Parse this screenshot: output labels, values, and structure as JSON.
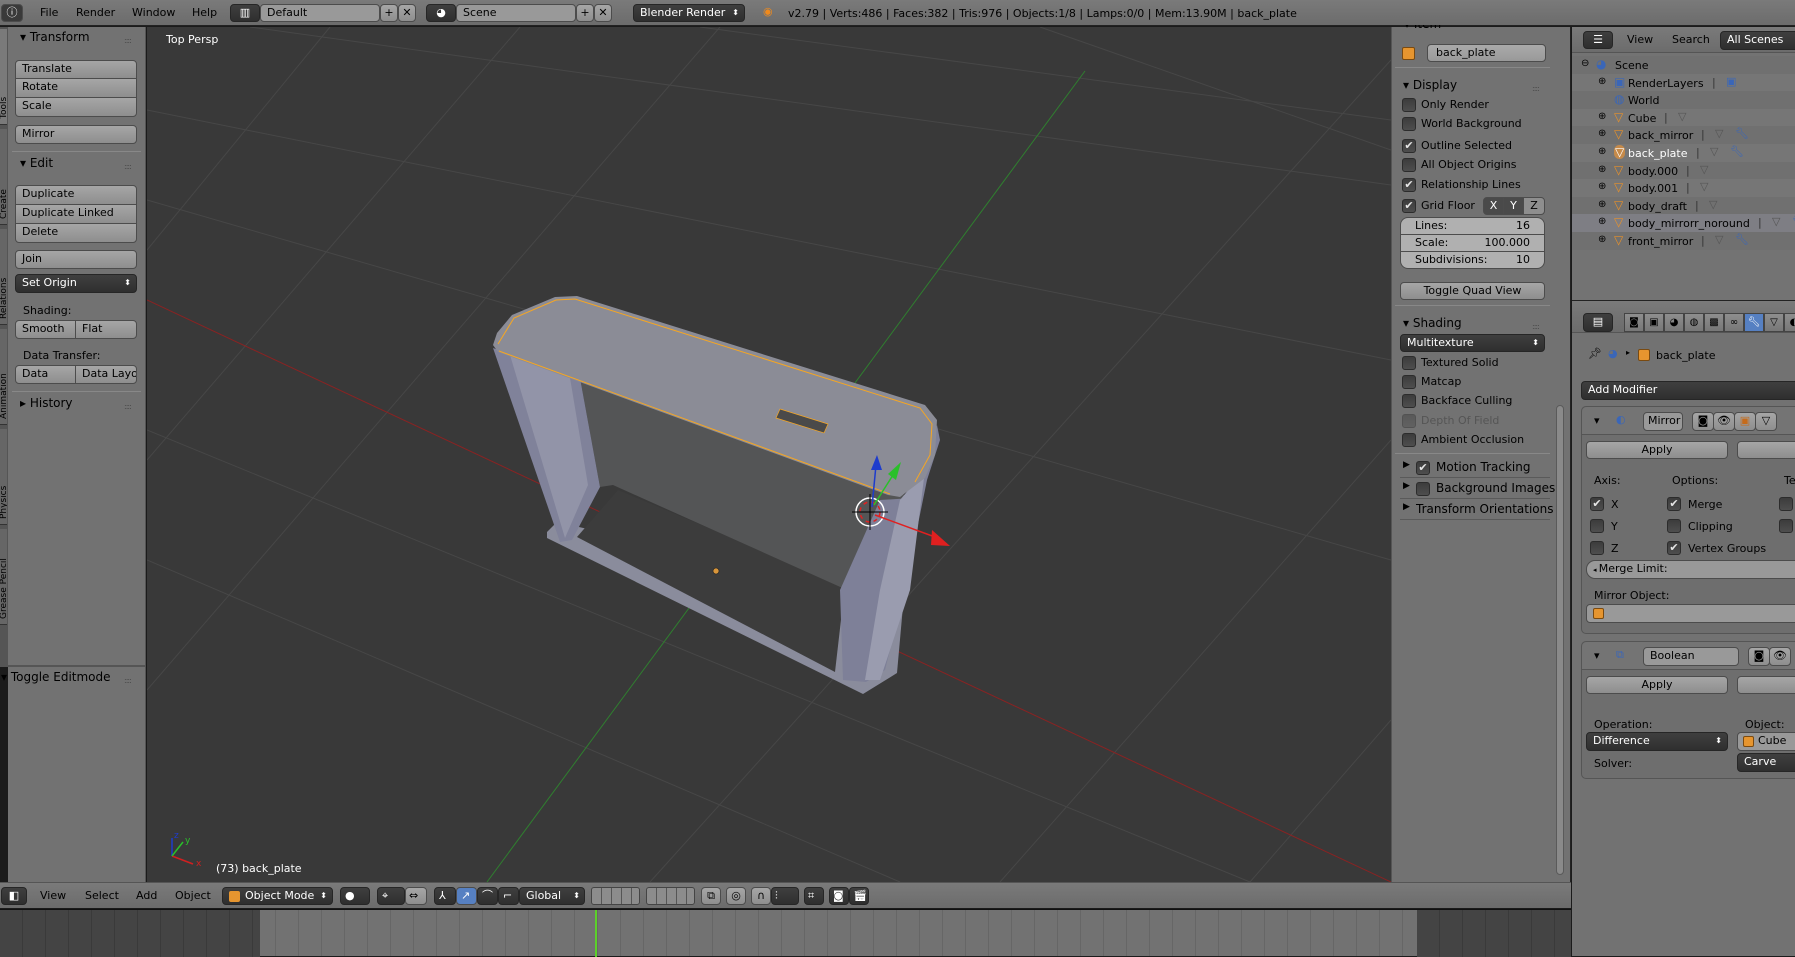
{
  "top_header": {
    "menus": [
      "File",
      "Render",
      "Window",
      "Help"
    ],
    "layout": "Default",
    "scene": "Scene",
    "engine": "Blender Render",
    "stats": "v2.79 | Verts:486 | Faces:382 | Tris:976 | Objects:1/8 | Lamps:0/0 | Mem:13.90M | back_plate"
  },
  "tool_tabs": [
    "Tools",
    "Create",
    "Relations",
    "Animation",
    "Physics",
    "Grease Pencil"
  ],
  "toolshelf": {
    "transform": {
      "title": "Transform",
      "buttons": [
        "Translate",
        "Rotate",
        "Scale"
      ],
      "mirror": "Mirror"
    },
    "edit": {
      "title": "Edit",
      "buttons": [
        "Duplicate",
        "Duplicate Linked",
        "Delete"
      ],
      "join": "Join",
      "set_origin": "Set Origin",
      "shading_label": "Shading:",
      "smooth": "Smooth",
      "flat": "Flat",
      "data_transfer_label": "Data Transfer:",
      "data": "Data",
      "data_layo": "Data Layo"
    },
    "history": "History",
    "operator": "Toggle Editmode"
  },
  "viewport": {
    "view_name": "Top Persp",
    "object_info": "(73) back_plate",
    "axis_x": "x",
    "axis_y": "y",
    "axis_z": "z"
  },
  "npanel": {
    "item_title": "Item",
    "object_name": "back_plate",
    "display": {
      "title": "Display",
      "options": [
        {
          "label": "Only Render",
          "checked": false
        },
        {
          "label": "World Background",
          "checked": false
        },
        {
          "label": "Outline Selected",
          "checked": true
        },
        {
          "label": "All Object Origins",
          "checked": false
        },
        {
          "label": "Relationship Lines",
          "checked": true
        },
        {
          "label": "Grid Floor",
          "checked": true
        }
      ],
      "axes": [
        "X",
        "Y",
        "Z"
      ],
      "lines_label": "Lines:",
      "lines": "16",
      "scale_label": "Scale:",
      "scale": "100.000",
      "subdiv_label": "Subdivisions:",
      "subdiv": "10",
      "quad_view": "Toggle Quad View"
    },
    "shading": {
      "title": "Shading",
      "mode": "Multitexture",
      "options": [
        {
          "label": "Textured Solid",
          "checked": false
        },
        {
          "label": "Matcap",
          "checked": false
        },
        {
          "label": "Backface Culling",
          "checked": false
        },
        {
          "label": "Depth Of Field",
          "checked": false,
          "disabled": true
        },
        {
          "label": "Ambient Occlusion",
          "checked": false
        }
      ]
    },
    "collapsed": [
      {
        "label": "Motion Tracking",
        "checkbox": true,
        "checked": true
      },
      {
        "label": "Background Images",
        "checkbox": true,
        "checked": false
      },
      {
        "label": "Transform Orientations",
        "checkbox": false
      }
    ]
  },
  "outliner": {
    "menus": [
      "View",
      "Search"
    ],
    "filter": "All Scenes",
    "items": [
      {
        "label": "Scene",
        "depth": 0,
        "icon": "scene"
      },
      {
        "label": "RenderLayers",
        "depth": 1,
        "icon": "renderlayers",
        "extra": "renderlayer"
      },
      {
        "label": "World",
        "depth": 1,
        "icon": "world"
      },
      {
        "label": "Cube",
        "depth": 1,
        "icon": "mesh",
        "extra": "mesh"
      },
      {
        "label": "back_mirror",
        "depth": 1,
        "icon": "mesh",
        "extra": "mesh",
        "modifier": true
      },
      {
        "label": "back_plate",
        "depth": 1,
        "icon": "mesh",
        "extra": "mesh",
        "modifier": true,
        "active": true
      },
      {
        "label": "body.000",
        "depth": 1,
        "icon": "mesh",
        "extra": "mesh"
      },
      {
        "label": "body.001",
        "depth": 1,
        "icon": "mesh",
        "extra": "mesh"
      },
      {
        "label": "body_draft",
        "depth": 1,
        "icon": "mesh",
        "extra": "mesh"
      },
      {
        "label": "body_mirrorr_noround",
        "depth": 1,
        "icon": "mesh",
        "extra": "mesh",
        "modifier": true,
        "highlight": true
      },
      {
        "label": "front_mirror",
        "depth": 1,
        "icon": "mesh",
        "extra": "mesh",
        "modifier": true
      }
    ]
  },
  "properties": {
    "active_tab": "modifiers",
    "breadcrumb": "back_plate",
    "add_modifier": "Add Modifier",
    "mirror": {
      "name": "Mirror",
      "apply": "Apply",
      "axis_label": "Axis:",
      "options_label": "Options:",
      "tex_label": "Te",
      "axes": [
        {
          "label": "X",
          "checked": true
        },
        {
          "label": "Y",
          "checked": false
        },
        {
          "label": "Z",
          "checked": false
        }
      ],
      "options": [
        {
          "label": "Merge",
          "checked": true
        },
        {
          "label": "Clipping",
          "checked": false
        },
        {
          "label": "Vertex Groups",
          "checked": true
        }
      ],
      "merge_limit": "Merge Limit:",
      "mirror_object": "Mirror Object:"
    },
    "boolean": {
      "name": "Boolean",
      "apply": "Apply",
      "operation_label": "Operation:",
      "operation": "Difference",
      "object_label": "Object:",
      "object": "Cube",
      "solver_label": "Solver:",
      "solver": "Carve"
    }
  },
  "view3d_header": {
    "menus": [
      "View",
      "Select",
      "Add",
      "Object"
    ],
    "mode": "Object Mode",
    "orientation": "Global"
  },
  "timeline": {
    "current_frame_marker": true
  },
  "colors": {
    "viewport": "#393939",
    "panel": "#727272",
    "selected_outline": "#f5a623",
    "x_axis": "#c81e1e",
    "y_axis": "#2a9a2a",
    "z_axis": "#1e3ccc",
    "active_tab": "#5680c2"
  }
}
